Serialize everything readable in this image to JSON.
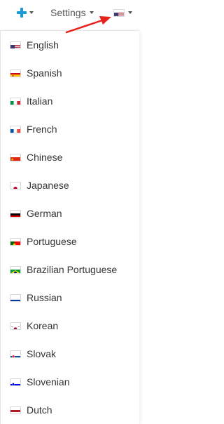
{
  "toolbar": {
    "add_icon": "plus-icon",
    "settings_label": "Settings",
    "current_language_flag": "us"
  },
  "language_menu": {
    "items": [
      {
        "label": "English",
        "flag": "us"
      },
      {
        "label": "Spanish",
        "flag": "es"
      },
      {
        "label": "Italian",
        "flag": "it"
      },
      {
        "label": "French",
        "flag": "fr"
      },
      {
        "label": "Chinese",
        "flag": "cn"
      },
      {
        "label": "Japanese",
        "flag": "jp"
      },
      {
        "label": "German",
        "flag": "de"
      },
      {
        "label": "Portuguese",
        "flag": "pt"
      },
      {
        "label": "Brazilian Portuguese",
        "flag": "br"
      },
      {
        "label": "Russian",
        "flag": "ru"
      },
      {
        "label": "Korean",
        "flag": "kr"
      },
      {
        "label": "Slovak",
        "flag": "sk"
      },
      {
        "label": "Slovenian",
        "flag": "si"
      },
      {
        "label": "Dutch",
        "flag": "nl"
      }
    ]
  },
  "colors": {
    "accent_plus": "#1a9bd6",
    "annotation_arrow": "#e8211b"
  }
}
